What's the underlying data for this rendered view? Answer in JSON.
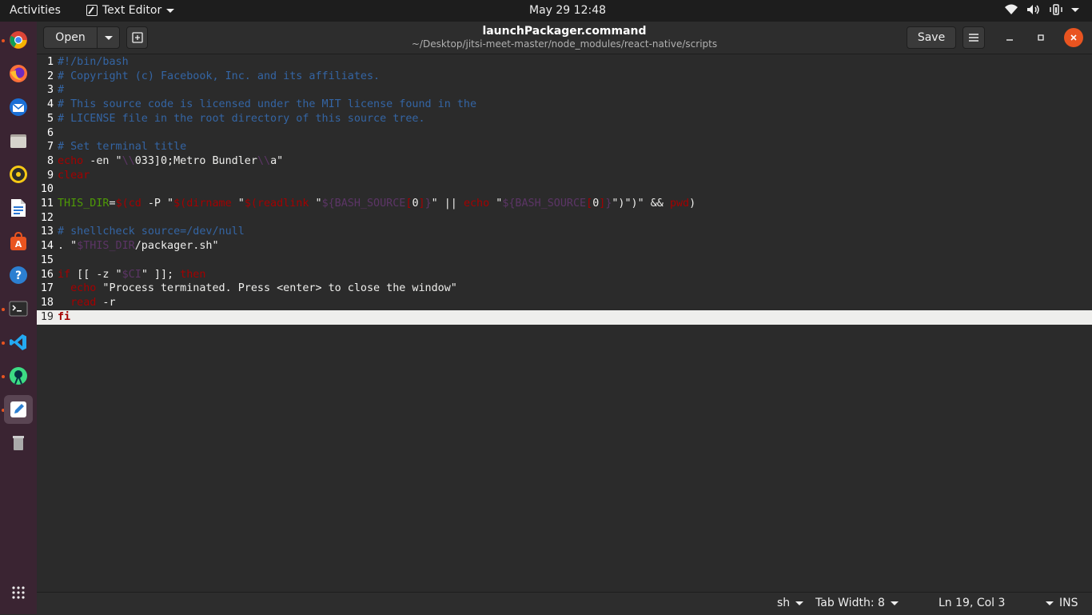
{
  "topbar": {
    "activities": "Activities",
    "app_name": "Text Editor",
    "clock": "May 29  12:48"
  },
  "dock": {
    "items": [
      "chrome-icon",
      "firefox-icon",
      "thunderbird-icon",
      "files-icon",
      "rhythmbox-icon",
      "writer-icon",
      "software-icon",
      "help-icon",
      "terminal-icon",
      "vscode-icon",
      "android-studio-icon",
      "text-editor-icon",
      "trash-icon"
    ]
  },
  "header": {
    "open_label": "Open",
    "title": "launchPackager.command",
    "subtitle": "~/Desktop/jitsi-meet-master/node_modules/react-native/scripts",
    "save_label": "Save"
  },
  "editor": {
    "current_line": 19,
    "lines": [
      {
        "n": "1",
        "t": "#!/bin/bash"
      },
      {
        "n": "2",
        "t": "# Copyright (c) Facebook, Inc. and its affiliates."
      },
      {
        "n": "3",
        "t": "#"
      },
      {
        "n": "4",
        "t": "# This source code is licensed under the MIT license found in the"
      },
      {
        "n": "5",
        "t": "# LICENSE file in the root directory of this source tree."
      },
      {
        "n": "6",
        "t": ""
      },
      {
        "n": "7",
        "t": "# Set terminal title"
      },
      {
        "n": "8",
        "t": "echo -en \"\\\\033]0;Metro Bundler\\\\a\""
      },
      {
        "n": "9",
        "t": "clear"
      },
      {
        "n": "10",
        "t": ""
      },
      {
        "n": "11",
        "t": "THIS_DIR=$(cd -P \"$(dirname \"$(readlink \"${BASH_SOURCE[0]}\" || echo \"${BASH_SOURCE[0]}\")\")\" && pwd)"
      },
      {
        "n": "12",
        "t": ""
      },
      {
        "n": "13",
        "t": "# shellcheck source=/dev/null"
      },
      {
        "n": "14",
        "t": ". \"$THIS_DIR/packager.sh\""
      },
      {
        "n": "15",
        "t": ""
      },
      {
        "n": "16",
        "t": "if [[ -z \"$CI\" ]]; then"
      },
      {
        "n": "17",
        "t": "  echo \"Process terminated. Press <enter> to close the window\""
      },
      {
        "n": "18",
        "t": "  read -r"
      },
      {
        "n": "19",
        "t": "fi"
      }
    ]
  },
  "status": {
    "language": "sh",
    "tab_width": "Tab Width: 8",
    "position": "Ln 19, Col 3",
    "mode": "INS"
  }
}
